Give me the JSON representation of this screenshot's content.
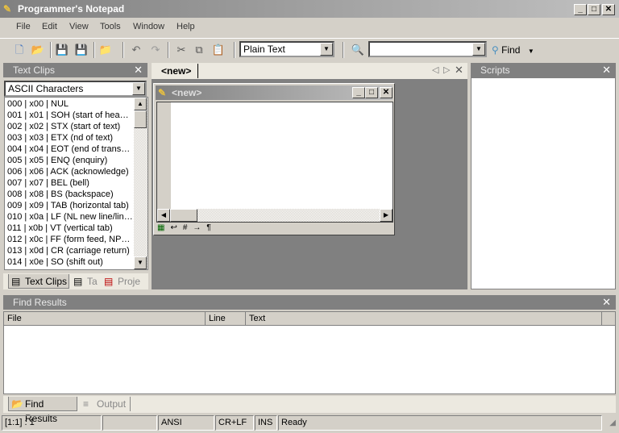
{
  "window": {
    "title": "Programmer's Notepad",
    "min": "_",
    "max": "□",
    "close": "✕"
  },
  "menu": [
    "File",
    "Edit",
    "View",
    "Tools",
    "Window",
    "Help"
  ],
  "toolbar": {
    "scheme": "Plain Text",
    "search_value": "",
    "find_label": "Find"
  },
  "text_clips": {
    "title": "Text Clips",
    "category": "ASCII Characters",
    "items": [
      "000 | x00 | NUL",
      "001 | x01 | SOH (start of hea…",
      "002 | x02 | STX (start of text)",
      "003 | x03 | ETX (nd of text)",
      "004 | x04 | EOT (end of trans…",
      "005 | x05 | ENQ (enquiry)",
      "006 | x06 | ACK (acknowledge)",
      "007 | x07 | BEL (bell)",
      "008 | x08 | BS (backspace)",
      "009 | x09 | TAB (horizontal tab)",
      "010 | x0a | LF (NL new line/lin…",
      "011 | x0b | VT (vertical tab)",
      "012 | x0c | FF (form feed, NP…",
      "013 | x0d | CR (carriage return)",
      "014 | x0e | SO (shift out)"
    ],
    "tabs": [
      "Text Clips",
      "Ta",
      "Proje"
    ]
  },
  "editor": {
    "tab": "<new>",
    "doc_title": "<new>"
  },
  "scripts": {
    "title": "Scripts"
  },
  "find_results": {
    "title": "Find Results",
    "columns": [
      "File",
      "Line",
      "Text"
    ]
  },
  "bottom_tabs": [
    "Find Results",
    "Output"
  ],
  "status": {
    "pos": "[1:1] : 1",
    "blank": "",
    "encoding": "ANSI",
    "eol": "CR+LF",
    "mode": "INS",
    "state": "Ready"
  }
}
